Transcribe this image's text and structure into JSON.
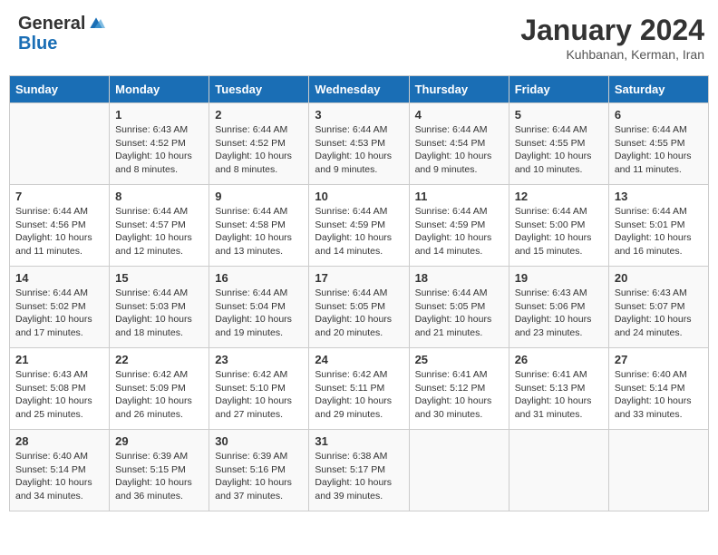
{
  "header": {
    "logo_general": "General",
    "logo_blue": "Blue",
    "title": "January 2024",
    "subtitle": "Kuhbanan, Kerman, Iran"
  },
  "columns": [
    "Sunday",
    "Monday",
    "Tuesday",
    "Wednesday",
    "Thursday",
    "Friday",
    "Saturday"
  ],
  "weeks": [
    [
      {
        "day": "",
        "info": ""
      },
      {
        "day": "1",
        "info": "Sunrise: 6:43 AM\nSunset: 4:52 PM\nDaylight: 10 hours\nand 8 minutes."
      },
      {
        "day": "2",
        "info": "Sunrise: 6:44 AM\nSunset: 4:52 PM\nDaylight: 10 hours\nand 8 minutes."
      },
      {
        "day": "3",
        "info": "Sunrise: 6:44 AM\nSunset: 4:53 PM\nDaylight: 10 hours\nand 9 minutes."
      },
      {
        "day": "4",
        "info": "Sunrise: 6:44 AM\nSunset: 4:54 PM\nDaylight: 10 hours\nand 9 minutes."
      },
      {
        "day": "5",
        "info": "Sunrise: 6:44 AM\nSunset: 4:55 PM\nDaylight: 10 hours\nand 10 minutes."
      },
      {
        "day": "6",
        "info": "Sunrise: 6:44 AM\nSunset: 4:55 PM\nDaylight: 10 hours\nand 11 minutes."
      }
    ],
    [
      {
        "day": "7",
        "info": "Sunrise: 6:44 AM\nSunset: 4:56 PM\nDaylight: 10 hours\nand 11 minutes."
      },
      {
        "day": "8",
        "info": "Sunrise: 6:44 AM\nSunset: 4:57 PM\nDaylight: 10 hours\nand 12 minutes."
      },
      {
        "day": "9",
        "info": "Sunrise: 6:44 AM\nSunset: 4:58 PM\nDaylight: 10 hours\nand 13 minutes."
      },
      {
        "day": "10",
        "info": "Sunrise: 6:44 AM\nSunset: 4:59 PM\nDaylight: 10 hours\nand 14 minutes."
      },
      {
        "day": "11",
        "info": "Sunrise: 6:44 AM\nSunset: 4:59 PM\nDaylight: 10 hours\nand 14 minutes."
      },
      {
        "day": "12",
        "info": "Sunrise: 6:44 AM\nSunset: 5:00 PM\nDaylight: 10 hours\nand 15 minutes."
      },
      {
        "day": "13",
        "info": "Sunrise: 6:44 AM\nSunset: 5:01 PM\nDaylight: 10 hours\nand 16 minutes."
      }
    ],
    [
      {
        "day": "14",
        "info": "Sunrise: 6:44 AM\nSunset: 5:02 PM\nDaylight: 10 hours\nand 17 minutes."
      },
      {
        "day": "15",
        "info": "Sunrise: 6:44 AM\nSunset: 5:03 PM\nDaylight: 10 hours\nand 18 minutes."
      },
      {
        "day": "16",
        "info": "Sunrise: 6:44 AM\nSunset: 5:04 PM\nDaylight: 10 hours\nand 19 minutes."
      },
      {
        "day": "17",
        "info": "Sunrise: 6:44 AM\nSunset: 5:05 PM\nDaylight: 10 hours\nand 20 minutes."
      },
      {
        "day": "18",
        "info": "Sunrise: 6:44 AM\nSunset: 5:05 PM\nDaylight: 10 hours\nand 21 minutes."
      },
      {
        "day": "19",
        "info": "Sunrise: 6:43 AM\nSunset: 5:06 PM\nDaylight: 10 hours\nand 23 minutes."
      },
      {
        "day": "20",
        "info": "Sunrise: 6:43 AM\nSunset: 5:07 PM\nDaylight: 10 hours\nand 24 minutes."
      }
    ],
    [
      {
        "day": "21",
        "info": "Sunrise: 6:43 AM\nSunset: 5:08 PM\nDaylight: 10 hours\nand 25 minutes."
      },
      {
        "day": "22",
        "info": "Sunrise: 6:42 AM\nSunset: 5:09 PM\nDaylight: 10 hours\nand 26 minutes."
      },
      {
        "day": "23",
        "info": "Sunrise: 6:42 AM\nSunset: 5:10 PM\nDaylight: 10 hours\nand 27 minutes."
      },
      {
        "day": "24",
        "info": "Sunrise: 6:42 AM\nSunset: 5:11 PM\nDaylight: 10 hours\nand 29 minutes."
      },
      {
        "day": "25",
        "info": "Sunrise: 6:41 AM\nSunset: 5:12 PM\nDaylight: 10 hours\nand 30 minutes."
      },
      {
        "day": "26",
        "info": "Sunrise: 6:41 AM\nSunset: 5:13 PM\nDaylight: 10 hours\nand 31 minutes."
      },
      {
        "day": "27",
        "info": "Sunrise: 6:40 AM\nSunset: 5:14 PM\nDaylight: 10 hours\nand 33 minutes."
      }
    ],
    [
      {
        "day": "28",
        "info": "Sunrise: 6:40 AM\nSunset: 5:14 PM\nDaylight: 10 hours\nand 34 minutes."
      },
      {
        "day": "29",
        "info": "Sunrise: 6:39 AM\nSunset: 5:15 PM\nDaylight: 10 hours\nand 36 minutes."
      },
      {
        "day": "30",
        "info": "Sunrise: 6:39 AM\nSunset: 5:16 PM\nDaylight: 10 hours\nand 37 minutes."
      },
      {
        "day": "31",
        "info": "Sunrise: 6:38 AM\nSunset: 5:17 PM\nDaylight: 10 hours\nand 39 minutes."
      },
      {
        "day": "",
        "info": ""
      },
      {
        "day": "",
        "info": ""
      },
      {
        "day": "",
        "info": ""
      }
    ]
  ]
}
